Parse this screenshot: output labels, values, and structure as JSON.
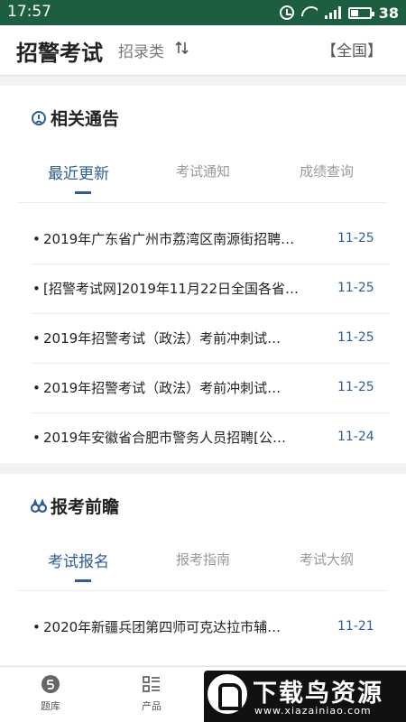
{
  "status_bar": {
    "time": "17:57",
    "battery": "38",
    "icons": [
      "alarm-icon",
      "wifi-icon",
      "signal-icon",
      "battery-icon"
    ]
  },
  "header": {
    "title": "招警考试",
    "category": "招录类",
    "sort_icon": "sort-icon",
    "region": "【全国】"
  },
  "announcements": {
    "section_title": "相关通告",
    "icon": "announcement-icon",
    "tabs": [
      {
        "label": "最近更新",
        "active": true
      },
      {
        "label": "考试通知",
        "active": false
      },
      {
        "label": "成绩查询",
        "active": false
      }
    ],
    "items": [
      {
        "title": "2019年广东省广州市荔湾区南源街招聘…",
        "date": "11-25"
      },
      {
        "title": "[招警考试网]2019年11月22日全国各省…",
        "date": "11-25"
      },
      {
        "title": "2019年招警考试（政法）考前冲刺试…",
        "date": "11-25"
      },
      {
        "title": "2019年招警考试（政法）考前冲刺试…",
        "date": "11-25"
      },
      {
        "title": "2019年安徽省合肥市警务人员招聘[公…",
        "date": "11-24"
      }
    ]
  },
  "preview": {
    "section_title": "报考前瞻",
    "icon": "binoculars-icon",
    "tabs": [
      {
        "label": "考试报名",
        "active": true
      },
      {
        "label": "报考指南",
        "active": false
      },
      {
        "label": "考试大纲",
        "active": false
      }
    ],
    "items": [
      {
        "title": "2020年新疆兵团第四师可克达拉市辅…",
        "date": "11-21"
      }
    ]
  },
  "bottom_nav": {
    "items": [
      {
        "label": "题库",
        "icon": "question-bank-icon"
      },
      {
        "label": "产品",
        "icon": "product-list-icon"
      }
    ]
  },
  "watermark": {
    "main": "下载鸟资源",
    "sub": "www.xiazainiao.com"
  },
  "colors": {
    "status_bar": "#1d5e40",
    "accent": "#2d5d95",
    "date": "#2d5d95",
    "background": "#f2f2f2"
  }
}
